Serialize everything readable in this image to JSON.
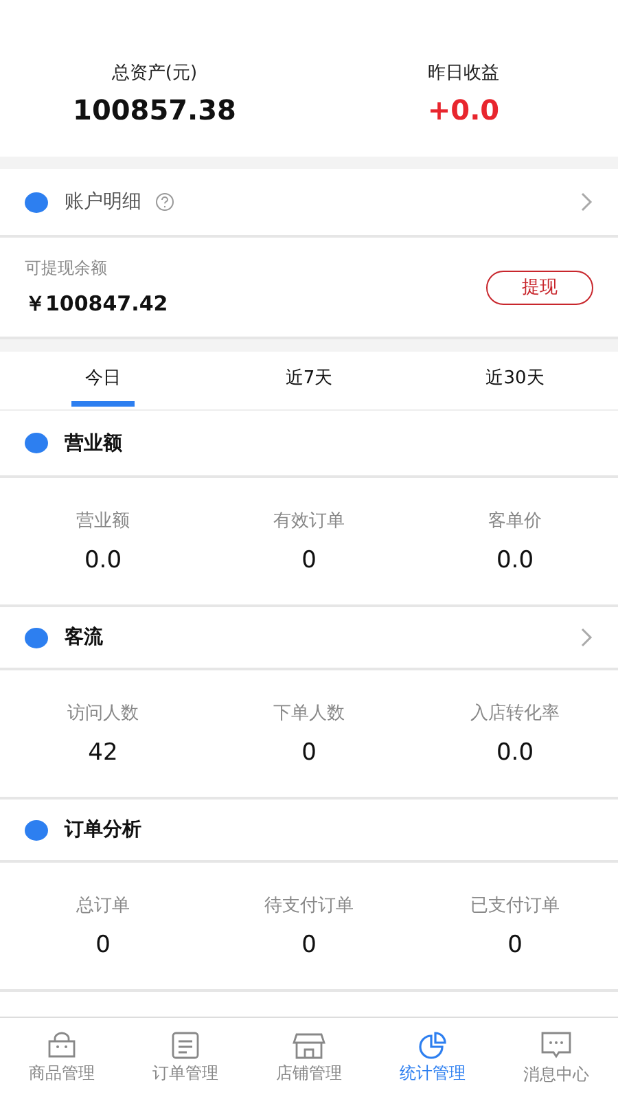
{
  "summary": [
    {
      "label": "总资产(元)",
      "value": "100857.38",
      "kind": "plain"
    },
    {
      "label": "昨日收益",
      "value": "+0.0",
      "kind": "profit"
    }
  ],
  "account": {
    "title": "账户明细",
    "help": true,
    "arrow": true
  },
  "balance": {
    "label": "可提现余额",
    "value": "￥100847.42",
    "button": "提现"
  },
  "tabs": [
    {
      "label": "今日",
      "selected": true
    },
    {
      "label": "近7天",
      "selected": false
    },
    {
      "label": "近30天",
      "selected": false
    }
  ],
  "sections": [
    {
      "title": "营业额",
      "arrow": false,
      "stats": [
        {
          "label": "营业额",
          "value": "0.0"
        },
        {
          "label": "有效订单",
          "value": "0"
        },
        {
          "label": "客单价",
          "value": "0.0"
        }
      ]
    },
    {
      "title": "客流",
      "arrow": true,
      "stats": [
        {
          "label": "访问人数",
          "value": "42"
        },
        {
          "label": "下单人数",
          "value": "0"
        },
        {
          "label": "入店转化率",
          "value": "0.0"
        }
      ]
    },
    {
      "title": "订单分析",
      "arrow": false,
      "stats": [
        {
          "label": "总订单",
          "value": "0"
        },
        {
          "label": "待支付订单",
          "value": "0"
        },
        {
          "label": "已支付订单",
          "value": "0"
        }
      ]
    }
  ],
  "tabbar": [
    {
      "label": "商品管理",
      "kind": "bag",
      "selected": false
    },
    {
      "label": "订单管理",
      "kind": "list",
      "selected": false
    },
    {
      "label": "店铺管理",
      "kind": "store",
      "selected": false
    },
    {
      "label": "统计管理",
      "kind": "pie",
      "selected": true
    },
    {
      "label": "消息中心",
      "kind": "message",
      "selected": false
    }
  ]
}
